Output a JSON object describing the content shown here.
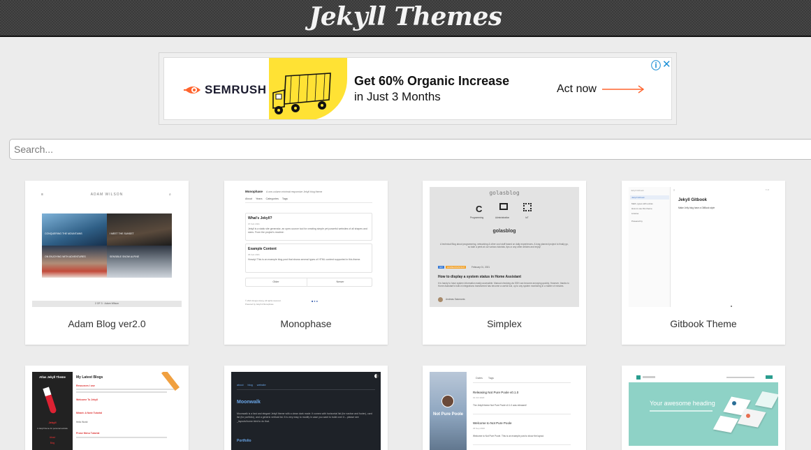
{
  "header": {
    "title": "Jekyll Themes"
  },
  "ad": {
    "brand": "SEMRUSH",
    "headline": "Get 60% Organic Increase",
    "subline": "in Just 3 Months",
    "cta": "Act now",
    "info_icon": "info-icon",
    "close_icon": "close-icon",
    "colors": {
      "brand": "#ff642d",
      "yellow": "#ffe234",
      "link": "#1a8fd6"
    }
  },
  "search": {
    "placeholder": "Search...",
    "value": ""
  },
  "themes": [
    {
      "name": "Adam Blog ver2.0"
    },
    {
      "name": "Monophase"
    },
    {
      "name": "Simplex"
    },
    {
      "name": "Gitbook Theme"
    },
    {
      "name": ""
    },
    {
      "name": ""
    },
    {
      "name": ""
    },
    {
      "name": ""
    }
  ],
  "previews": {
    "adam": {
      "site_name": "ADAM WILSON",
      "tile1": "CONQUERING THE MOUNTAINS",
      "tile2": "I MEET THE SUNSET",
      "tile3": "ON ENJOYING WITH ADVENTURES",
      "tile4": "SENSIBLE SNOW ALPINE",
      "footer": "2 OF 3 · Adam Wilson"
    },
    "monophase": {
      "brand": "Monophase",
      "tagline": "A one-column minimal responsive Jekyll blog theme",
      "nav": [
        "About",
        "Years",
        "Categories",
        "Tags"
      ],
      "post1_title": "What's Jekyll?",
      "post1_date": "07 Feb 2021",
      "post1_text": "Jekyll is a static site generator, an open-source tool for creating simple yet powerful websites of all shapes and sizes. From the project's readme:",
      "post2_title": "Example Content",
      "post2_date": "06 Feb 2021",
      "post2_text": "Howdy! This is an example blog post that shows several types of HTML content supported in this theme.",
      "older": "Older",
      "newer": "Newer",
      "copyright": "© 2021 Zongrui Hong. All rights reserved.",
      "powered": "Powered by Jekyll & Monophase"
    },
    "simplex": {
      "logo": "golasblog",
      "cat1": "Programming",
      "cat2": "Administration",
      "cat3": "IoT",
      "heading": "golasblog",
      "desc": "A technical Blog about programming, networking & other cool stuff based on daily experiences. A long planned project to finally go, so take a peek at our various tutorials, tips or any other articles and enjoy!",
      "tag1": "IOT",
      "tag2": "HOMEASSISTANT",
      "date": "February 01, 2021",
      "post_title": "How to display a system status in Home Assistant",
      "post_text": "It is handy to have system information easily accessible. Manual checking via SSH can become annoying quickly. However, thanks to Home Assistant's built-in integrations transformed has become a useful tool, up to any system monitoring in a matter of minutes.",
      "author": "Andreas Salomonis"
    },
    "gitbook": {
      "sidebar_title": "Jekyll Gitbook",
      "side_items": [
        "Jekyll Gitbook",
        "Math, types with extras",
        "How to use this theme",
        "License",
        "Powered by"
      ],
      "title": "Jekyll Gitbook",
      "text": "Make Jelly blog have a GitBook style"
    },
    "atlas": {
      "title": "Atlas Jekyll Theme",
      "heading": "My Latest Blogs",
      "items": [
        "Resources I use",
        "Welcome To Jekyll",
        "Mirant: A Note Tutorial",
        "Hello World",
        "Prose Menu Tutorial"
      ],
      "brand": "Jekyll",
      "tagline": "A Jekyll theme for personal website",
      "menu": [
        "About",
        "Blog"
      ]
    },
    "moonwalk": {
      "nav": [
        "about",
        "blog",
        "website"
      ],
      "title": "Moonwalk",
      "text": "Moonwalk is a fast and elegant Jekyll theme with a clean dark mode. It comes with horizontal list (for navbar and footer), card list (for portfolio), and a generic vertical list. It is very easy to modify in case you want to build over it – please see _layouts/home.html to do that.",
      "section": "Portfolio"
    },
    "notpure": {
      "nav": [
        "Dates",
        "Tags"
      ],
      "hero": "Not Pure Poole",
      "post1_title": "Releasing Not Pure Poole v0.1.0",
      "post1_date": "01 Oct 2020",
      "post1_text": "The Jekyll theme Not Pure Poole v0.1.0 was released!",
      "post2_title": "Welcome to Not Pure Poole",
      "post2_date": "29 Sep 2020",
      "post2_text": "Welcome to Not Pure Poole. This is an example post to show the layout."
    },
    "landing": {
      "headline": "Your awesome heading",
      "colors": {
        "bg": "#8ed2c6"
      }
    }
  }
}
